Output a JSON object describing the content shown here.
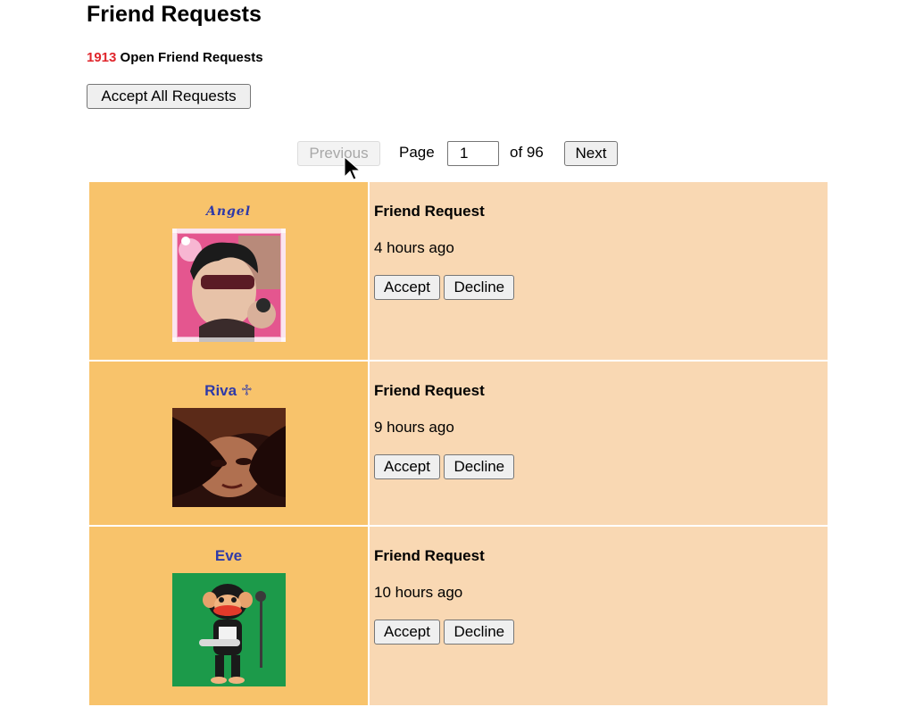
{
  "page": {
    "title": "Friend Requests",
    "open_count": "1913",
    "open_label": " Open Friend Requests",
    "accept_all_label": "Accept All Requests"
  },
  "pagination": {
    "previous_label": "Previous",
    "page_label": "Page",
    "current_page": "1",
    "of_label": "of 96",
    "next_label": "Next"
  },
  "requests": [
    {
      "name": "Angel",
      "title": "Friend Request",
      "time": "4 hours ago",
      "accept_label": "Accept",
      "decline_label": "Decline"
    },
    {
      "name": "Riva ♱",
      "title": "Friend Request",
      "time": "9 hours ago",
      "accept_label": "Accept",
      "decline_label": "Decline"
    },
    {
      "name": "Eve",
      "title": "Friend Request",
      "time": "10 hours ago",
      "accept_label": "Accept",
      "decline_label": "Decline"
    }
  ],
  "colors": {
    "count_red": "#e0262c",
    "name_blue": "#2f3aa8",
    "left_cell": "#f8c36b",
    "right_cell": "#f9d8b3"
  }
}
